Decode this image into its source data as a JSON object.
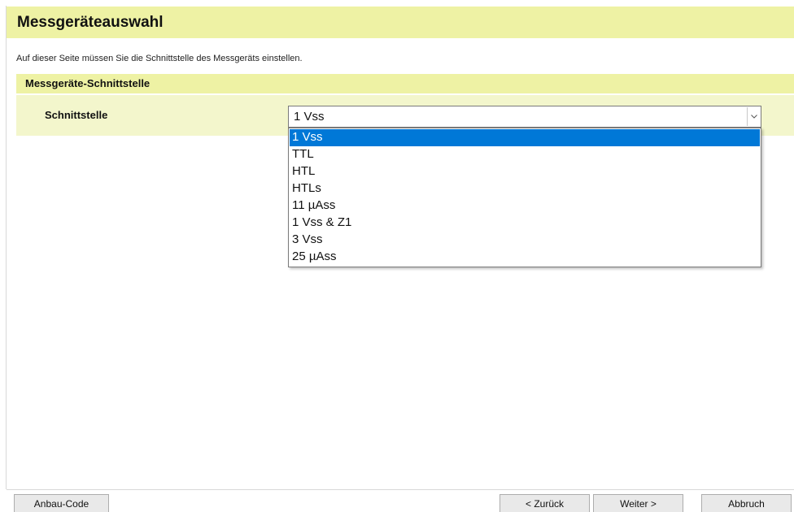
{
  "header": {
    "title": "Messgeräteauswahl",
    "description": "Auf dieser Seite müssen Sie die Schnittstelle des Messgeräts einstellen."
  },
  "section": {
    "title": "Messgeräte-Schnittstelle"
  },
  "interface_field": {
    "label": "Schnittstelle",
    "selected_value": "1 Vss",
    "options": [
      "1 Vss",
      "TTL",
      "HTL",
      "HTLs",
      "11 µAss",
      "1 Vss & Z1",
      "3 Vss",
      "25 µAss"
    ],
    "highlighted_index": 0
  },
  "footer": {
    "anbau_code_label": "Anbau-Code",
    "back_label": "< Zurück",
    "next_label": "Weiter >",
    "cancel_label": "Abbruch"
  },
  "colors": {
    "header_bg": "#eef2a4",
    "row_bg": "#f3f6cc",
    "selection": "#0078d7"
  },
  "icons": {
    "dropdown_arrow": "chevron-down-icon"
  }
}
